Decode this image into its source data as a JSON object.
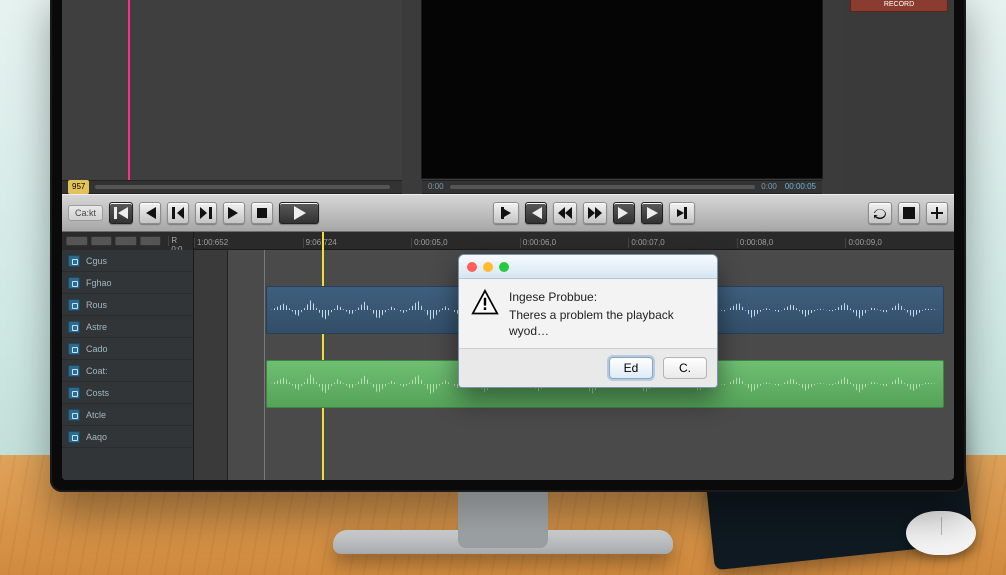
{
  "right_panel": {
    "button_label": "RECORD"
  },
  "footer": {
    "left_tc": "957",
    "right_tc_left": "0:00",
    "right_tc_right": "0:00",
    "right_status": "00:00:05"
  },
  "transport": {
    "label_left": "Ca:kt"
  },
  "ruler": {
    "strip_label": "R 0:0",
    "marks": [
      "1:00:652",
      "9:06:724",
      "0:00:05,0",
      "0:00:06,0",
      "0:00:07,0",
      "0:00:08,0",
      "0:00:09,0"
    ]
  },
  "bin": {
    "items": [
      {
        "label": "Cgus"
      },
      {
        "label": "Fghao"
      },
      {
        "label": "Rous"
      },
      {
        "label": "Astre"
      },
      {
        "label": "Cado"
      },
      {
        "label": "Coat:"
      },
      {
        "label": "Costs"
      },
      {
        "label": "Atcle"
      },
      {
        "label": "Aaqo"
      }
    ]
  },
  "dialog": {
    "title_line": "Ingese Probbue:",
    "body_line": "Theres a problem the playback wyod…",
    "primary": "Ed",
    "secondary": "C."
  }
}
